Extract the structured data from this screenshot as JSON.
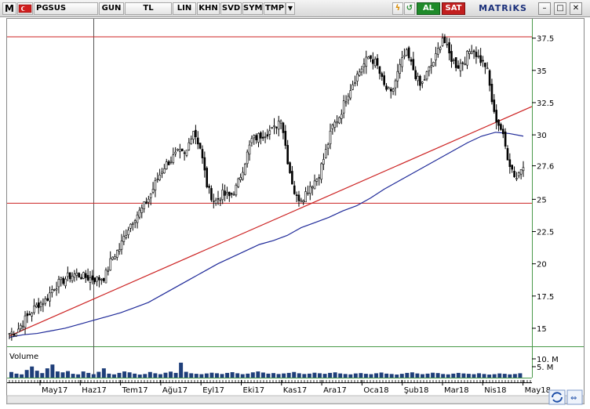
{
  "toolbar": {
    "logo_letter": "M",
    "symbol": "PGSUS",
    "period": "GUN",
    "currency": "TL",
    "scale_lin": "LIN",
    "scale_khn": "KHN",
    "scale_svd": "SVD",
    "scale_sym": "SYM",
    "scale_tmp": "TMP",
    "buy": "AL",
    "sell": "SAT",
    "brand": "MATRiKS",
    "minimize": "–",
    "restore": "□",
    "close": "✕"
  },
  "colors": {
    "trend_line": "#cc2222",
    "horizontal_lines": "#cc2222",
    "moving_average": "#1f2a99",
    "volume": "#1f3f7a",
    "candles": "#000000",
    "al": "#1f8a2a",
    "sat": "#c21f1f"
  },
  "chart_data": {
    "type": "candlestick",
    "symbol": "PGSUS",
    "x_tick_labels": [
      "May17",
      "Haz17",
      "Tem17",
      "Ağu17",
      "Eyl17",
      "Eki17",
      "Kas17",
      "Ara17",
      "Oca18",
      "Şub18",
      "Mar18",
      "Nis18",
      "May18"
    ],
    "y_tick_labels": [
      "37.5",
      "35",
      "32.5",
      "30",
      "27.6",
      "25",
      "22.5",
      "20",
      "17.5",
      "15"
    ],
    "ylim": [
      13.6,
      39.0
    ],
    "close_series": [
      14.6,
      14.8,
      15.6,
      16.3,
      16.9,
      17.2,
      18.2,
      18.6,
      19.0,
      19.2,
      19.0,
      18.9,
      18.8,
      19.0,
      20.5,
      21.2,
      22.6,
      23.6,
      24.2,
      25.1,
      26.4,
      27.5,
      28.1,
      28.6,
      28.4,
      30.5,
      29.0,
      25.8,
      24.8,
      25.4,
      25.2,
      26.0,
      27.8,
      29.6,
      29.9,
      30.2,
      30.4,
      31.4,
      27.7,
      25.1,
      25.2,
      26.1,
      26.7,
      28.5,
      30.6,
      31.5,
      33.1,
      34.3,
      35.2,
      36.1,
      35.5,
      33.8,
      33.1,
      35.0,
      36.4,
      35.1,
      33.7,
      34.9,
      35.9,
      37.6,
      36.1,
      35.3,
      35.8,
      36.8,
      35.9,
      35.3,
      31.6,
      30.4,
      28.0,
      26.6,
      27.8
    ],
    "ma_series": [
      14.3,
      14.5,
      14.6,
      14.8,
      15.0,
      15.3,
      15.6,
      15.9,
      16.2,
      16.6,
      17.0,
      17.6,
      18.2,
      18.8,
      19.4,
      20.0,
      20.5,
      21.0,
      21.5,
      21.8,
      22.2,
      22.8,
      23.2,
      23.6,
      24.1,
      24.5,
      25.1,
      25.8,
      26.4,
      27.0,
      27.6,
      28.2,
      28.8,
      29.4,
      29.9,
      30.2,
      30.1,
      29.9
    ],
    "trend_line": {
      "from": [
        0,
        14.4
      ],
      "to": [
        1,
        32.2
      ]
    },
    "horizontal_levels": [
      37.6,
      24.7
    ],
    "volume_label": "Volume",
    "volume_ticks": [
      "10. M",
      "5. M"
    ],
    "volume_values": [
      3.1,
      2.2,
      1.8,
      4.2,
      6.1,
      3.8,
      2.5,
      5.1,
      7.2,
      3.4,
      2.9,
      3.6,
      2.1,
      1.8,
      3.4,
      2.6,
      1.9,
      3.2,
      5.1,
      2.2,
      1.8,
      2.6,
      3.4,
      2.9,
      2.2,
      1.7,
      2.0,
      3.1,
      2.4,
      1.9,
      2.7,
      3.3,
      2.6,
      8.2,
      3.2,
      2.4,
      2.1,
      1.9,
      2.3,
      2.7,
      2.4,
      2.0,
      2.6,
      3.0,
      2.4,
      1.9,
      2.2,
      2.9,
      3.4,
      2.8,
      2.2,
      2.5,
      2.0,
      2.3,
      2.6,
      3.1,
      2.4,
      2.0,
      2.2,
      2.7,
      2.4,
      2.1,
      2.6,
      2.9,
      2.3,
      2.0,
      1.8,
      2.3,
      2.5,
      2.1,
      1.9,
      2.4,
      2.8,
      2.2,
      2.0,
      1.7,
      2.1,
      2.6,
      2.9,
      2.3,
      1.9,
      2.2,
      2.7,
      2.5,
      2.0,
      1.8,
      2.2,
      2.6,
      2.3,
      2.1,
      1.9,
      2.4,
      2.0,
      1.7,
      1.9,
      2.3,
      2.1,
      1.8,
      2.0,
      2.4
    ]
  }
}
